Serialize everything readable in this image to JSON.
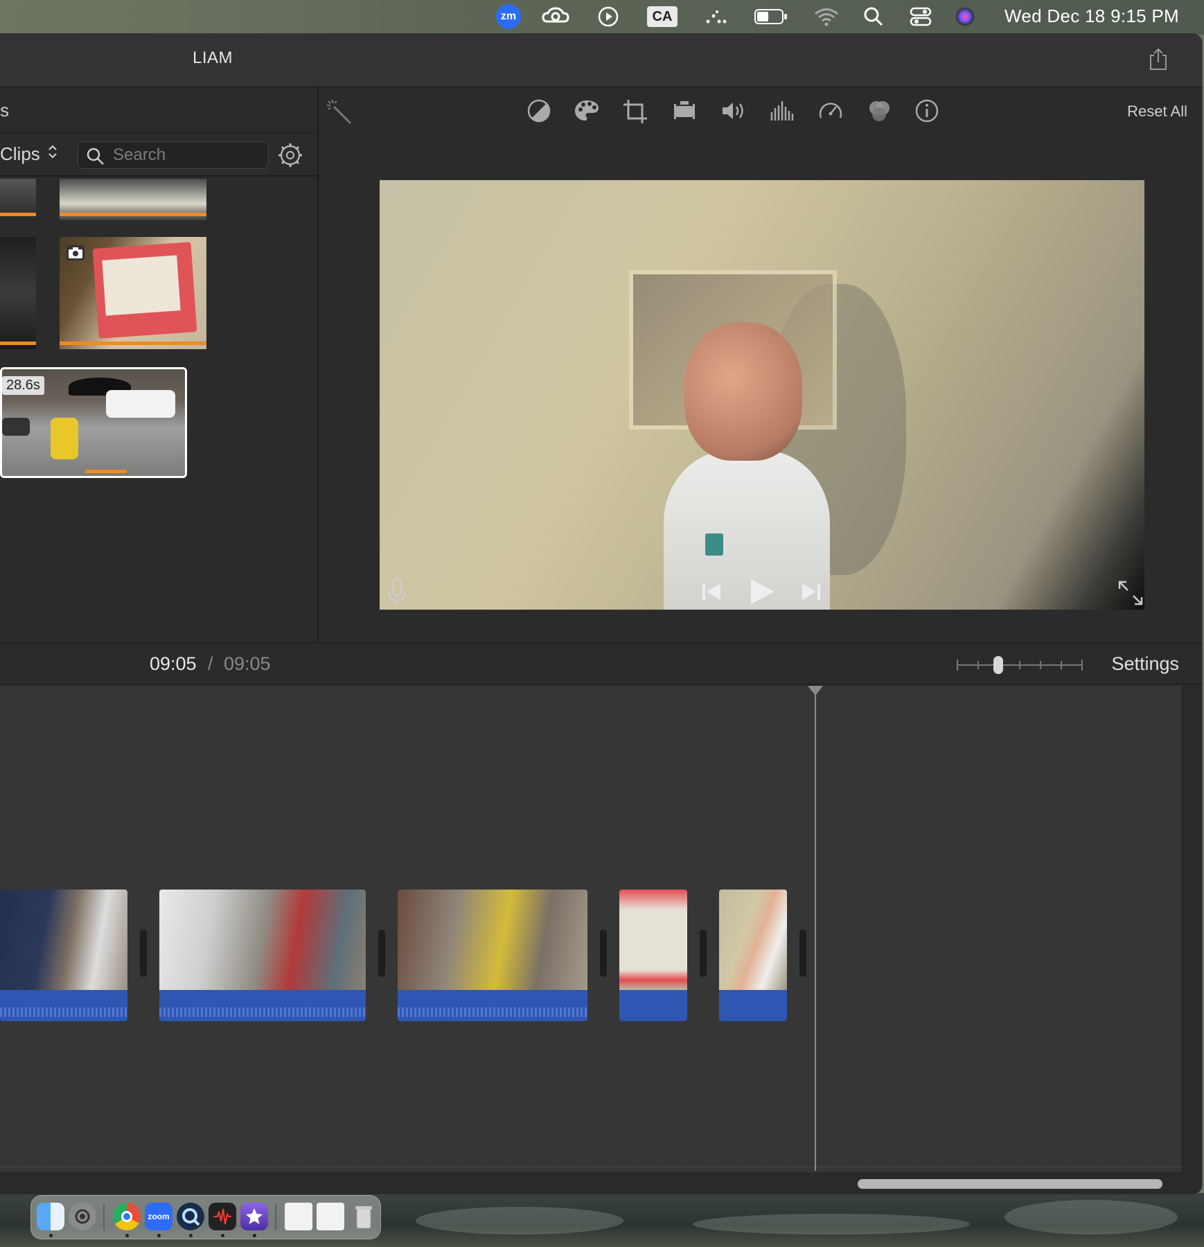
{
  "menubar": {
    "zoom_label": "zm",
    "keyboard_input": "CA",
    "clock": "Wed Dec 18  9:15 PM"
  },
  "window": {
    "project_title": "LIAM"
  },
  "browser": {
    "header_partial": "s",
    "clips_label": "Clips",
    "search_placeholder": "Search",
    "selected_clip_duration": "28.6s"
  },
  "viewer": {
    "reset_all_label": "Reset All",
    "tools": [
      "magic-wand",
      "color-balance",
      "color-correction",
      "crop",
      "stabilization",
      "volume",
      "noise-reduction",
      "speed",
      "clip-filter",
      "clip-info"
    ]
  },
  "timeline": {
    "timecode_current": "09:05",
    "timecode_separator": "/",
    "timecode_total": "09:05",
    "settings_label": "Settings"
  },
  "dock": {
    "zoom_label": "zoom"
  },
  "colors": {
    "accent_orange": "#f28a1e",
    "audio_blue": "#2f56b3",
    "window_bg": "#2a2a2a"
  }
}
